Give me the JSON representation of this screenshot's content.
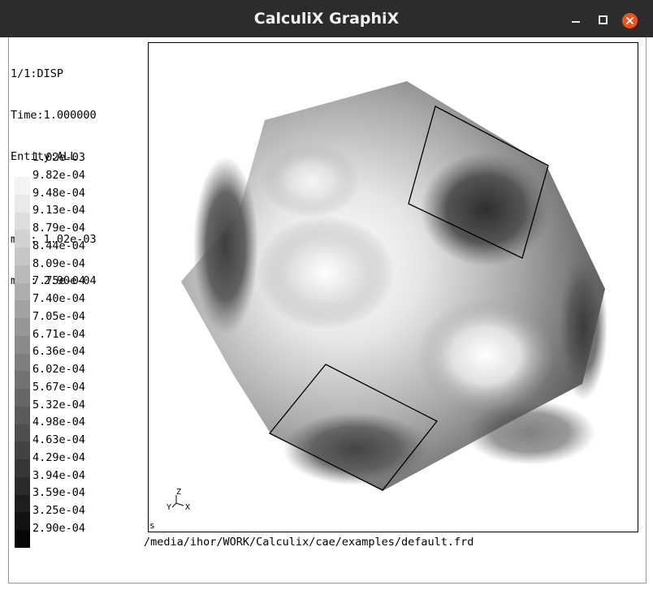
{
  "window": {
    "title": "CalculiX GraphiX"
  },
  "info": {
    "dataset": "1/1:DISP",
    "time": "Time:1.000000",
    "entity": "Entity:ALL",
    "max": "max: 1.02e-03",
    "min": "min: 2.90e-04"
  },
  "legend": {
    "values": [
      "1.02e-03",
      "9.82e-04",
      "9.48e-04",
      "9.13e-04",
      "8.79e-04",
      "8.44e-04",
      "8.09e-04",
      "7.75e-04",
      "7.40e-04",
      "7.05e-04",
      "6.71e-04",
      "6.36e-04",
      "6.02e-04",
      "5.67e-04",
      "5.32e-04",
      "4.98e-04",
      "4.63e-04",
      "4.29e-04",
      "3.94e-04",
      "3.59e-04",
      "3.25e-04",
      "2.90e-04"
    ],
    "swatch_colors": [
      "#f4f4f4",
      "#e9e9e9",
      "#dedede",
      "#d2d2d2",
      "#c6c6c6",
      "#bababa",
      "#aeaeae",
      "#a2a2a2",
      "#969696",
      "#8a8a8a",
      "#7e7e7e",
      "#727272",
      "#666666",
      "#5a5a5a",
      "#4e4e4e",
      "#424242",
      "#363636",
      "#2a2a2a",
      "#1e1e1e",
      "#121212",
      "#060606"
    ]
  },
  "axes": {
    "x": "X",
    "y": "Y",
    "z": "Z"
  },
  "marker": "s",
  "file_path": "/media/ihor/WORK/Calculix/cae/examples/default.frd"
}
